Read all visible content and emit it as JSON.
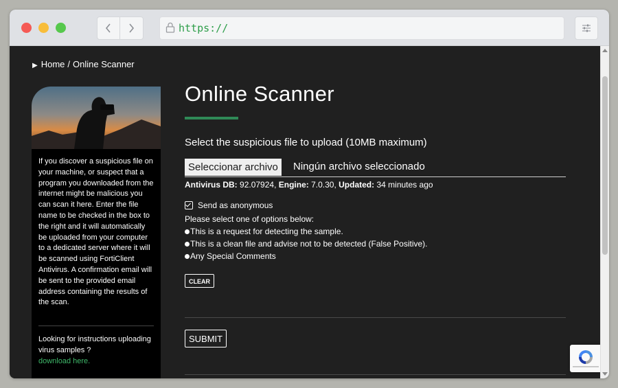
{
  "browser": {
    "url": "https://",
    "back_icon": "chevron-left-icon",
    "forward_icon": "chevron-right-icon",
    "lock_icon": "lock-icon",
    "menu_icon": "settings-sliders-icon",
    "accent_url_color": "#2e9e4a"
  },
  "breadcrumb": {
    "arrow": "▶",
    "home": "Home",
    "separator": "/",
    "current": "Online Scanner"
  },
  "sidebar": {
    "description": "If you discover a suspicious file on your machine, or suspect that a program you downloaded from the internet might be malicious you can scan it here. Enter the file name to be checked in the box to the right and it will automatically be uploaded from your computer to a dedicated server where it will be scanned using FortiClient Antivirus. A confirmation email will be sent to the provided email address containing the results of the scan.",
    "help_text": "Looking for instructions uploading virus samples ?",
    "help_link": "download here.",
    "link_color": "#3fb86a"
  },
  "main": {
    "title": "Online Scanner",
    "accent_color": "#2f8a57",
    "upload_label": "Select the suspicious file to upload (10MB maximum)",
    "file_button": "Seleccionar archivo",
    "file_status": "Ningún archivo seleccionado",
    "antivirus": {
      "db_label": "Antivirus DB:",
      "db_value": "92.07924,",
      "engine_label": "Engine:",
      "engine_value": "7.0.30,",
      "updated_label": "Updated:",
      "updated_value": "34 minutes ago"
    },
    "anonymous_label": "Send as anonymous",
    "anonymous_checked": true,
    "options_prompt": "Please select one of options below:",
    "options": [
      "This is a request for detecting the sample.",
      "This is a clean file and advise not to be detected (False Positive).",
      "Any Special Comments"
    ],
    "clear_button": "CLEAR",
    "submit_button": "SUBMIT"
  }
}
